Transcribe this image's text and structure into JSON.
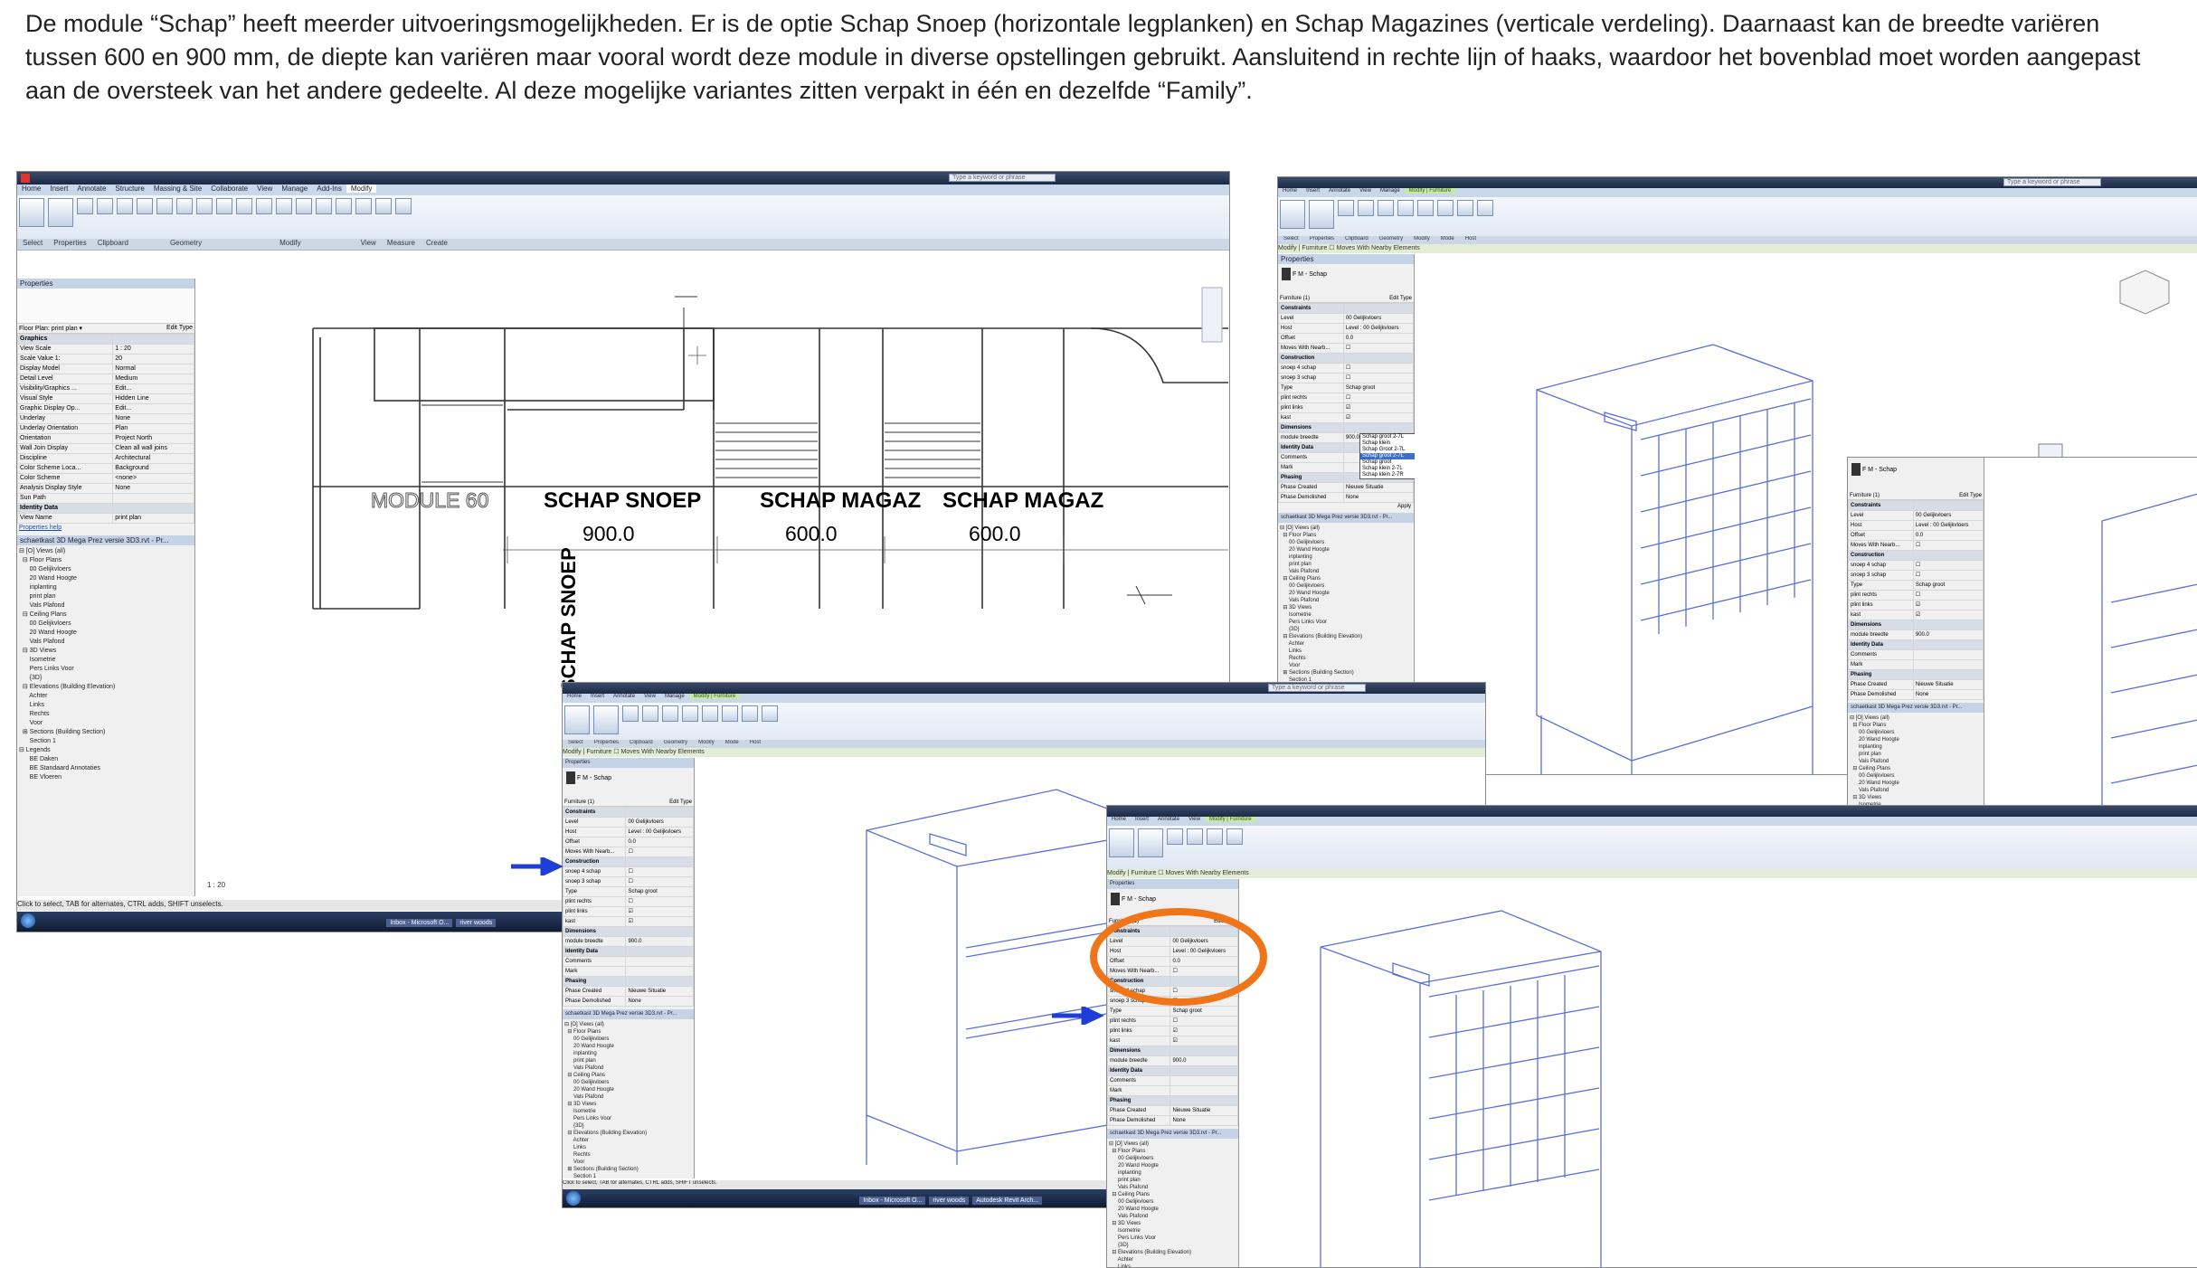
{
  "intro": "De module “Schap” heeft meerder uitvoeringsmogelijkheden.  Er is de optie Schap Snoep (horizontale legplanken) en Schap Magazines (verticale verdeling).  Daarnaast kan de breedte variëren tussen 600 en 900 mm, de diepte kan variëren maar vooral wordt deze module in diverse opstellingen gebruikt.  Aansluitend in rechte lijn of haaks, waardoor het bovenblad moet worden aangepast aan de oversteek van het andere gedeelte.  Al deze mogelijke variantes zitten verpakt in één en dezelfde “Family”.",
  "colors": {
    "ribbon_tab_context": "#c9e7a8",
    "arrow": "#1f3ed6",
    "circle": "#f07418",
    "titlebar": "#1c2a44"
  },
  "revit": {
    "search_placeholder": "Type a keyword or phrase",
    "tabs": [
      "Home",
      "Insert",
      "Annotate",
      "Structure",
      "Massing & Site",
      "Collaborate",
      "View",
      "Manage",
      "Add-Ins",
      "Modify"
    ],
    "context_tab": "Modify | Furniture",
    "ribbon_groups": [
      "Select",
      "Properties",
      "Clipboard",
      "Geometry",
      "Modify",
      "View",
      "Measure",
      "Create"
    ],
    "ribbon_groups_ctx": [
      "Select",
      "Properties",
      "Clipboard",
      "Geometry",
      "Modify",
      "View",
      "Measure",
      "Create",
      "Mode",
      "Host"
    ],
    "context_bar": "Modify | Furniture    ☐ Moves With Nearby Elements",
    "properties_title": "Properties",
    "family_name": "F M - Schap",
    "furniture_selector": "Furniture (1)",
    "edit_type": "Edit Type",
    "status": "Click to select, TAB for alternates, CTRL adds, SHIFT unselects.",
    "scale_label": "1 : 20",
    "apply": "Apply",
    "properties_help": "Properties help"
  },
  "floorplan_props": {
    "selector": "Floor Plan: print plan",
    "rows": [
      {
        "k": "Graphics",
        "v": "",
        "cat": true
      },
      {
        "k": "View Scale",
        "v": "1 : 20"
      },
      {
        "k": "Scale Value 1:",
        "v": "20"
      },
      {
        "k": "Display Model",
        "v": "Normal"
      },
      {
        "k": "Detail Level",
        "v": "Medium"
      },
      {
        "k": "Visibility/Graphics ...",
        "v": "Edit..."
      },
      {
        "k": "Visual Style",
        "v": "Hidden Line"
      },
      {
        "k": "Graphic Display Op...",
        "v": "Edit..."
      },
      {
        "k": "Underlay",
        "v": "None"
      },
      {
        "k": "Underlay Orientation",
        "v": "Plan"
      },
      {
        "k": "Orientation",
        "v": "Project North"
      },
      {
        "k": "Wall Join Display",
        "v": "Clean all wall joins"
      },
      {
        "k": "Discipline",
        "v": "Architectural"
      },
      {
        "k": "Color Scheme Loca...",
        "v": "Background"
      },
      {
        "k": "Color Scheme",
        "v": "<none>"
      },
      {
        "k": "Analysis Display Style",
        "v": "None"
      },
      {
        "k": "Sun Path",
        "v": ""
      },
      {
        "k": "Identity Data",
        "v": "",
        "cat": true
      },
      {
        "k": "View Name",
        "v": "print plan"
      }
    ]
  },
  "furniture_props": [
    {
      "k": "Constraints",
      "v": "",
      "cat": true
    },
    {
      "k": "Level",
      "v": "00 Gelijkvloers"
    },
    {
      "k": "Host",
      "v": "Level : 00 Gelijkvloers"
    },
    {
      "k": "Offset",
      "v": "0.0"
    },
    {
      "k": "Moves With Nearb...",
      "v": "☐"
    },
    {
      "k": "Construction",
      "v": "",
      "cat": true
    },
    {
      "k": "snoep 4 schap",
      "v": "☐"
    },
    {
      "k": "snoep 3 schap",
      "v": "☐"
    },
    {
      "k": "Type",
      "v": "Schap groot"
    },
    {
      "k": "plint rechts",
      "v": "☐"
    },
    {
      "k": "plint links",
      "v": "☑"
    },
    {
      "k": "kast",
      "v": "☑"
    },
    {
      "k": "Dimensions",
      "v": "",
      "cat": true
    },
    {
      "k": "module breedte",
      "v": "900.0"
    },
    {
      "k": "Identity Data",
      "v": "",
      "cat": true
    },
    {
      "k": "Comments",
      "v": ""
    },
    {
      "k": "Mark",
      "v": ""
    },
    {
      "k": "Phasing",
      "v": "",
      "cat": true
    },
    {
      "k": "Phase Created",
      "v": "Nieuwe Situatie"
    },
    {
      "k": "Phase Demolished",
      "v": "None"
    }
  ],
  "type_dropdown": [
    "Schap groot 2-7L",
    "Schap klein",
    "Schap Groot 2-7L",
    "Schap groot 2-7L",
    "Schap groot",
    "Schap klein 2-7L",
    "Schap klein 2-7R"
  ],
  "type_dropdown_selected": "Schap groot 2-7L",
  "browser": {
    "title": "schaetkast 3D Mega Prez versie 3D3.rvt - Pr...",
    "items": [
      "⊟ [O] Views (all)",
      "  ⊟ Floor Plans",
      "      00 Gelijkvloers",
      "      20 Wand Hoogte",
      "      inplanting",
      "      print plan",
      "      Vals Plafond",
      "  ⊟ Ceiling Plans",
      "      00 Gelijkvloers",
      "      20 Wand Hoogte",
      "      Vals Plafond",
      "  ⊟ 3D Views",
      "      Isometrie",
      "      Pers Links Voor",
      "      {3D}",
      "  ⊟ Elevations (Building Elevation)",
      "      Achter",
      "      Links",
      "      Rechts",
      "      Voor",
      "  ⊞ Sections (Building Section)",
      "      Section 1",
      "⊟ Legends",
      "      BE Daken",
      "      BE Standaard Annotaties",
      "      BE Vloeren"
    ]
  },
  "plan": {
    "labels": [
      {
        "text": "MODULE 60",
        "style": "outline"
      },
      {
        "text": "SCHAP SNOEP",
        "style": "bold"
      },
      {
        "text": "SCHAP MAGAZ",
        "style": "bold"
      },
      {
        "text": "SCHAP MAGAZ",
        "style": "bold"
      }
    ],
    "dims": [
      "900.0",
      "600.0",
      "600.0"
    ],
    "vertical_label": "SCHAP SNOEP"
  },
  "taskbar": [
    "Inbox - Microsoft O...",
    "river woods",
    "Autodesk Revit Arch..."
  ]
}
